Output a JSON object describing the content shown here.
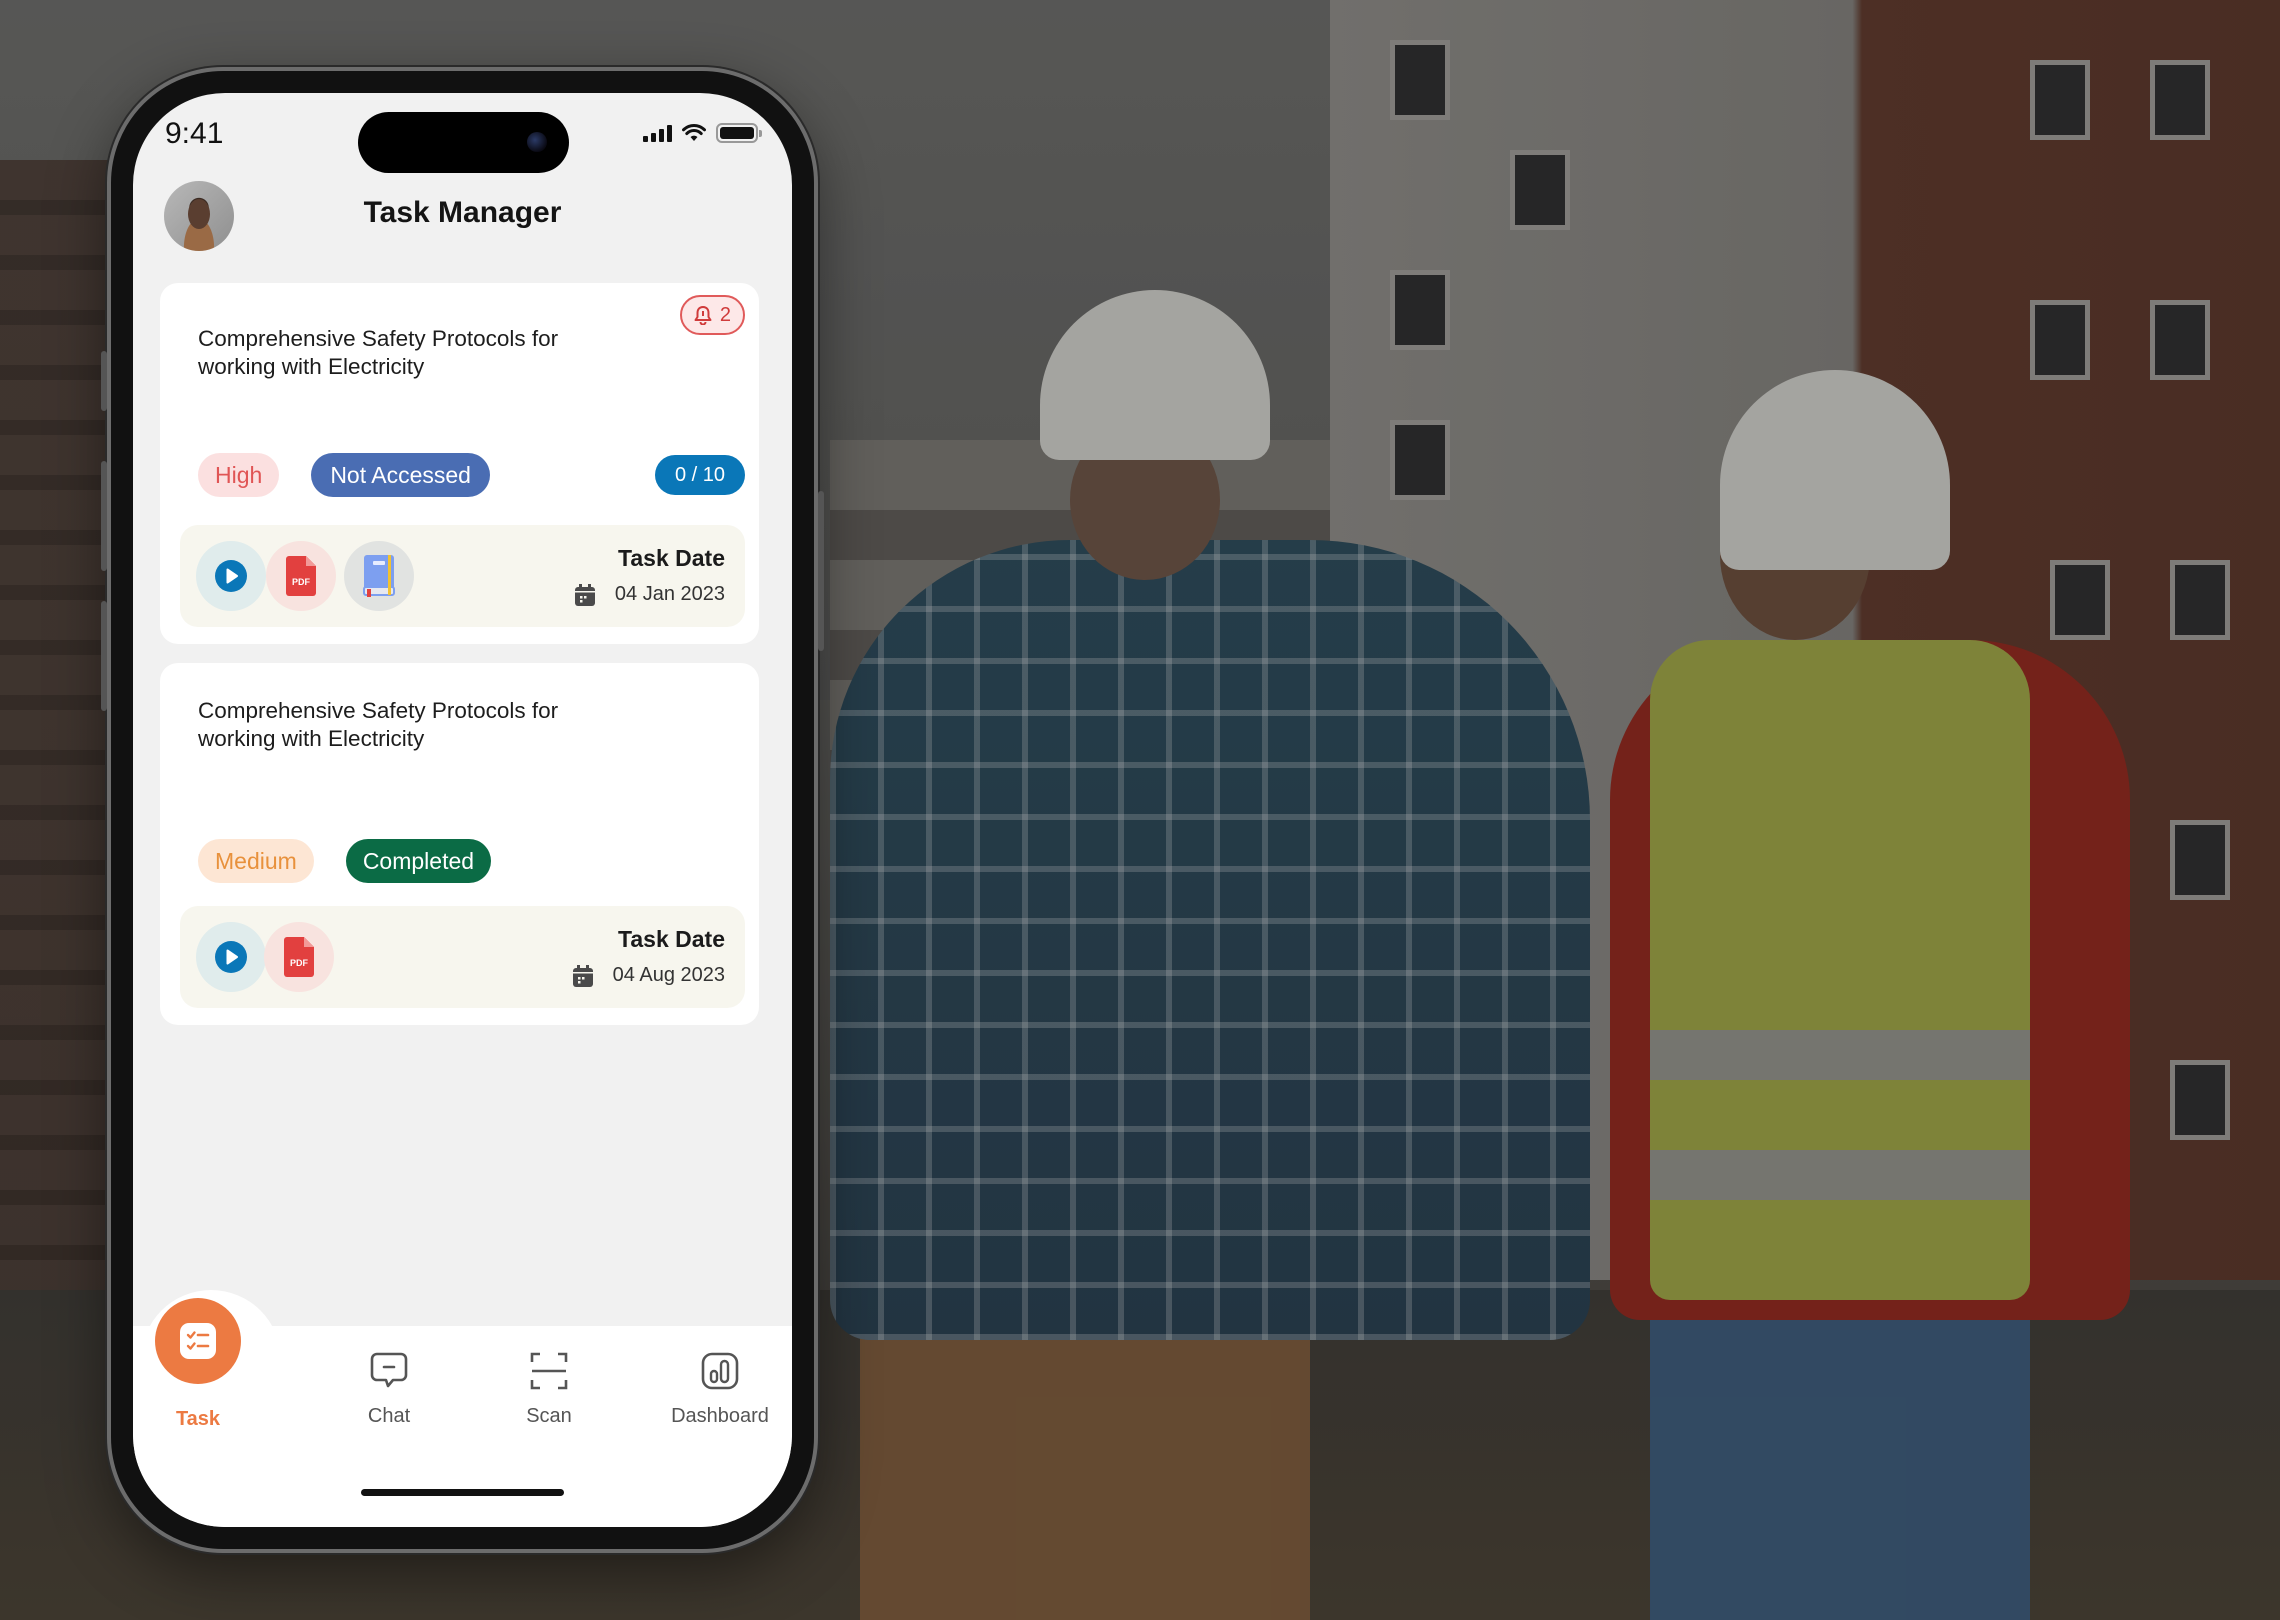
{
  "status_bar": {
    "time": "9:41"
  },
  "header": {
    "title": "Task Manager",
    "avatar_alt": "user-avatar"
  },
  "tasks": [
    {
      "title": "Comprehensive Safety Protocols for working with Electricity",
      "alert_count": "2",
      "priority": "High",
      "status": "Not Accessed",
      "progress": "0 / 10",
      "attachments": [
        "video",
        "pdf",
        "book"
      ],
      "date_label": "Task Date",
      "date": "04 Jan 2023"
    },
    {
      "title": "Comprehensive Safety Protocols for working with Electricity",
      "priority": "Medium",
      "status": "Completed",
      "attachments": [
        "video",
        "pdf"
      ],
      "date_label": "Task Date",
      "date": "04 Aug 2023"
    }
  ],
  "nav": {
    "active": "Task",
    "items": [
      {
        "label": "Task",
        "icon": "checklist-icon"
      },
      {
        "label": "Chat",
        "icon": "chat-icon"
      },
      {
        "label": "Scan",
        "icon": "scan-icon"
      },
      {
        "label": "Dashboard",
        "icon": "dashboard-icon"
      }
    ]
  },
  "colors": {
    "accent": "#ec7a42",
    "high": "#e05555",
    "medium": "#e8913c",
    "not_accessed": "#4a6db3",
    "completed": "#0b6b45",
    "progress": "#0a77b8"
  },
  "pdf_label": "PDF"
}
